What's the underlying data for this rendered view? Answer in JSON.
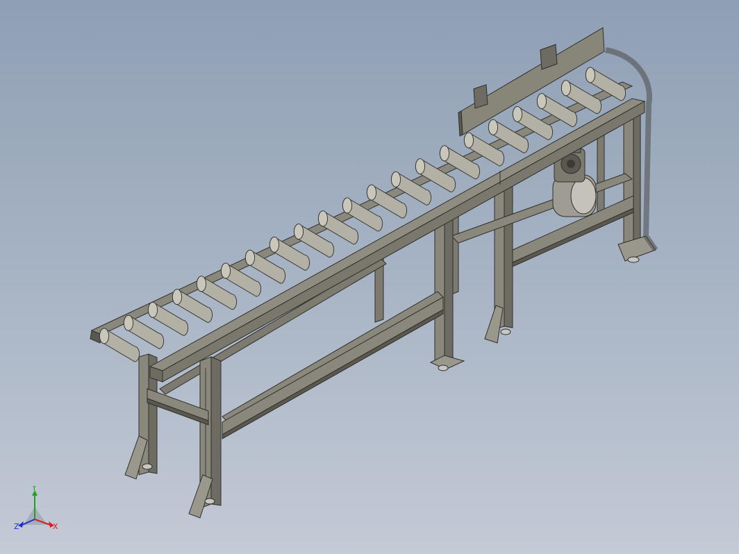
{
  "viewport": {
    "background_top": "#8f9fb4",
    "background_bottom": "#c4cad6"
  },
  "model": {
    "name": "roller-conveyor-assembly",
    "roller_count": 21,
    "colors": {
      "frame": "#8a877c",
      "frame_shadow": "#5a584f",
      "roller": "#b3b1a5",
      "roller_edge": "#3a3a36",
      "motor": "#9e9c93",
      "guide_plate": "#888579"
    }
  },
  "triad": {
    "x_label": "X",
    "y_label": "Y",
    "z_label": "Z",
    "x_color": "#d42020",
    "y_color": "#20a020",
    "z_color": "#2030d0"
  }
}
